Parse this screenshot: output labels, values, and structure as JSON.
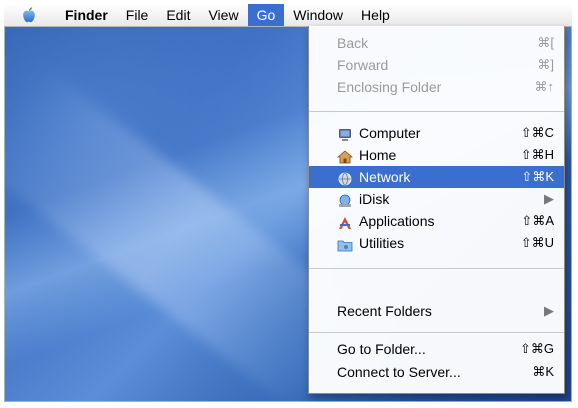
{
  "menubar": {
    "items": [
      {
        "label": "Finder",
        "bold": true
      },
      {
        "label": "File"
      },
      {
        "label": "Edit"
      },
      {
        "label": "View"
      },
      {
        "label": "Go",
        "active": true
      },
      {
        "label": "Window"
      },
      {
        "label": "Help"
      }
    ]
  },
  "go_menu": {
    "back": {
      "label": "Back",
      "shortcut": "⌘["
    },
    "forward": {
      "label": "Forward",
      "shortcut": "⌘]"
    },
    "enclosing": {
      "label": "Enclosing Folder",
      "shortcut": "⌘↑"
    },
    "computer": {
      "label": "Computer",
      "shortcut": "⇧⌘C",
      "icon": "computer-icon"
    },
    "home": {
      "label": "Home",
      "shortcut": "⇧⌘H",
      "icon": "home-icon"
    },
    "network": {
      "label": "Network",
      "shortcut": "⇧⌘K",
      "icon": "network-icon"
    },
    "idisk": {
      "label": "iDisk",
      "submenu": "▶",
      "icon": "idisk-icon"
    },
    "applications": {
      "label": "Applications",
      "shortcut": "⇧⌘A",
      "icon": "applications-icon"
    },
    "utilities": {
      "label": "Utilities",
      "shortcut": "⇧⌘U",
      "icon": "utilities-folder-icon"
    },
    "recent": {
      "label": "Recent Folders",
      "submenu": "▶"
    },
    "goto": {
      "label": "Go to Folder...",
      "shortcut": "⇧⌘G"
    },
    "connect": {
      "label": "Connect to Server...",
      "shortcut": "⌘K"
    }
  },
  "colors": {
    "highlight": "#3a6fd0",
    "desktop": "#2f5fb0",
    "disabled_text": "#9a9a9a"
  }
}
